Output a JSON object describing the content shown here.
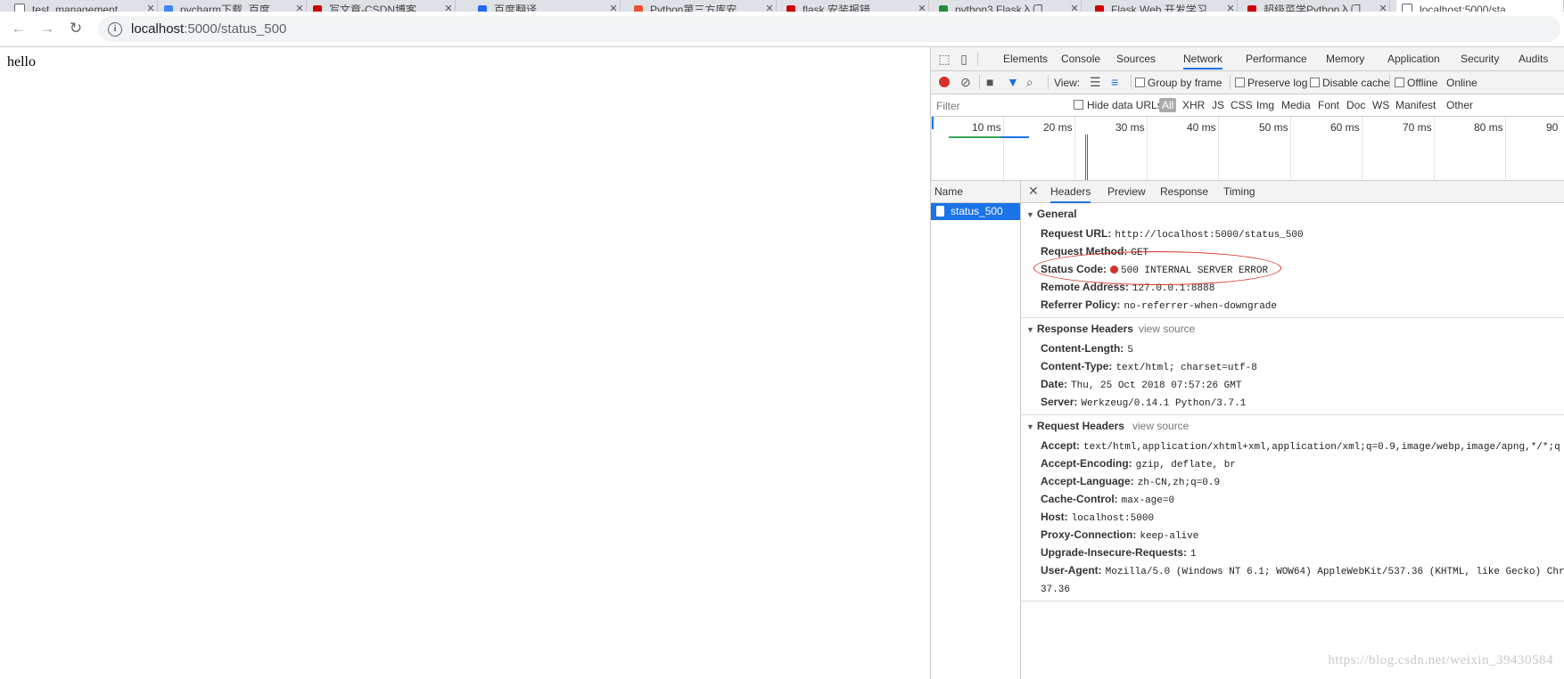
{
  "tabs": [
    {
      "title": "test_management",
      "favicon_color": "#5f6368"
    },
    {
      "title": "pycharm下载_百度",
      "favicon_color": "#4285f4"
    },
    {
      "title": "写文章-CSDN博客",
      "favicon_color": "#c00"
    },
    {
      "title": "百度翻译",
      "favicon_color": "#2468f2"
    },
    {
      "title": "Python第三方库安",
      "favicon_color": "#e8542e"
    },
    {
      "title": "flask 安装报错",
      "favicon_color": "#c00"
    },
    {
      "title": "python3 Flask入门",
      "favicon_color": "#1f8f3a"
    },
    {
      "title": "Flask Web 开发学习",
      "favicon_color": "#c00"
    },
    {
      "title": "超级菜学Python入门",
      "favicon_color": "#c00"
    },
    {
      "title": "localhost:5000/sta",
      "favicon_color": "#5f6368"
    }
  ],
  "address": {
    "host": "localhost",
    "path": ":5000/status_500",
    "back": "←",
    "forward": "→",
    "reload": "↻",
    "info_icon": "info-icon"
  },
  "page": {
    "body_text": "hello"
  },
  "devtools": {
    "tabs": [
      "Elements",
      "Console",
      "Sources",
      "Network",
      "Performance",
      "Memory",
      "Application",
      "Security",
      "Audits"
    ],
    "active_tab": "Network",
    "toolbar": {
      "view_label": "View:",
      "group_by_frame": "Group by frame",
      "preserve_log": "Preserve log",
      "disable_cache": "Disable cache",
      "offline": "Offline",
      "online": "Online"
    },
    "filter": {
      "placeholder": "Filter",
      "hide_data_urls": "Hide data URLs",
      "types": [
        "All",
        "XHR",
        "JS",
        "CSS",
        "Img",
        "Media",
        "Font",
        "Doc",
        "WS",
        "Manifest",
        "Other"
      ]
    },
    "timeline_ticks": [
      "10 ms",
      "20 ms",
      "30 ms",
      "40 ms",
      "50 ms",
      "60 ms",
      "70 ms",
      "80 ms",
      "90"
    ],
    "list": {
      "header": "Name",
      "rows": [
        "status_500"
      ]
    },
    "detail_tabs": [
      "Headers",
      "Preview",
      "Response",
      "Timing"
    ],
    "active_detail_tab": "Headers",
    "general": {
      "title": "General",
      "items": [
        {
          "key": "Request URL:",
          "value": "http://localhost:5000/status_500"
        },
        {
          "key": "Request Method:",
          "value": "GET"
        },
        {
          "key": "Status Code:",
          "value": "500 INTERNAL SERVER ERROR"
        },
        {
          "key": "Remote Address:",
          "value": "127.0.0.1:8888"
        },
        {
          "key": "Referrer Policy:",
          "value": "no-referrer-when-downgrade"
        }
      ]
    },
    "response_headers": {
      "title": "Response Headers",
      "view_source": "view source",
      "items": [
        {
          "key": "Content-Length:",
          "value": "5"
        },
        {
          "key": "Content-Type:",
          "value": "text/html; charset=utf-8"
        },
        {
          "key": "Date:",
          "value": "Thu, 25 Oct 2018 07:57:26 GMT"
        },
        {
          "key": "Server:",
          "value": "Werkzeug/0.14.1 Python/3.7.1"
        }
      ]
    },
    "request_headers": {
      "title": "Request Headers",
      "view_source": "view source",
      "items": [
        {
          "key": "Accept:",
          "value": "text/html,application/xhtml+xml,application/xml;q=0.9,image/webp,image/apng,*/*;q"
        },
        {
          "key": "Accept-Encoding:",
          "value": "gzip, deflate, br"
        },
        {
          "key": "Accept-Language:",
          "value": "zh-CN,zh;q=0.9"
        },
        {
          "key": "Cache-Control:",
          "value": "max-age=0"
        },
        {
          "key": "Host:",
          "value": "localhost:5000"
        },
        {
          "key": "Proxy-Connection:",
          "value": "keep-alive"
        },
        {
          "key": "Upgrade-Insecure-Requests:",
          "value": "1"
        },
        {
          "key": "User-Agent:",
          "value": "Mozilla/5.0 (Windows NT 6.1; WOW64) AppleWebKit/537.36 (KHTML, like Gecko) Chr"
        }
      ],
      "wrap": "37.36"
    }
  },
  "watermark": "https://blog.csdn.net/weixin_39430584"
}
